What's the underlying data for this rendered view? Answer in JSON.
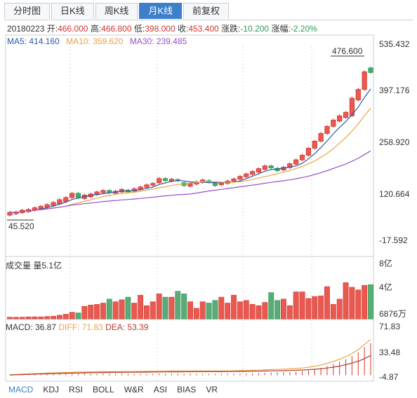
{
  "tabs": [
    {
      "label": "分时图",
      "active": false
    },
    {
      "label": "日K线",
      "active": false
    },
    {
      "label": "周K线",
      "active": false
    },
    {
      "label": "月K线",
      "active": true
    },
    {
      "label": "前复权",
      "active": false
    }
  ],
  "ohlc": {
    "date": "20180223",
    "open_label": "开:",
    "open": "466.000",
    "high_label": "高:",
    "high": "466.800",
    "low_label": "低:",
    "low": "398.000",
    "close_label": "收:",
    "close": "453.400",
    "change_label": "涨跌:",
    "change": "-10.200",
    "pct_label": "涨幅:",
    "pct": "-2.20%"
  },
  "ma": {
    "ma5": "MA5: 414.160",
    "ma10": "MA10: 359.620",
    "ma30": "MA30: 239.485"
  },
  "volume": {
    "label": "成交量 量5.1亿"
  },
  "macd": {
    "macd": "MACD: 36.87",
    "diff": "DIFF: 71.83",
    "dea": "DEA: 53.39"
  },
  "bottom_tabs": [
    "MACD",
    "KDJ",
    "RSI",
    "BOLL",
    "W&R",
    "ASI",
    "BIAS",
    "VR"
  ],
  "colors": {
    "up": "#d2352d",
    "down": "#2d9a52",
    "ma5": "#2b5aa8",
    "ma10": "#e8a34a",
    "ma30": "#9a4fc4",
    "accent": "#3d7fcb"
  },
  "chart_data": {
    "type": "candlestick",
    "price_axis_ticks": [
      "535.432",
      "397.176",
      "258.920",
      "120.664",
      "-17.592"
    ],
    "price_ylim": [
      -17.592,
      535.432
    ],
    "max_label": "476.600",
    "min_label": "45.520",
    "volume_axis_ticks": [
      "8亿",
      "4亿",
      "6876万"
    ],
    "volume_ylim": [
      0,
      8
    ],
    "macd_axis_ticks": [
      "71.83",
      "33.48",
      "-4.87"
    ],
    "macd_ylim": [
      -4.87,
      71.83
    ],
    "candles": [
      [
        48,
        56
      ],
      [
        52,
        57
      ],
      [
        55,
        62
      ],
      [
        58,
        64
      ],
      [
        62,
        69
      ],
      [
        66,
        73
      ],
      [
        70,
        78
      ],
      [
        75,
        84
      ],
      [
        80,
        92
      ],
      [
        86,
        98
      ],
      [
        98,
        110
      ],
      [
        110,
        98
      ],
      [
        95,
        105
      ],
      [
        100,
        108
      ],
      [
        106,
        114
      ],
      [
        112,
        118
      ],
      [
        118,
        112
      ],
      [
        110,
        116
      ],
      [
        114,
        121
      ],
      [
        119,
        114
      ],
      [
        116,
        123
      ],
      [
        121,
        128
      ],
      [
        127,
        134
      ],
      [
        133,
        138
      ],
      [
        140,
        152
      ],
      [
        152,
        146
      ],
      [
        145,
        150
      ],
      [
        149,
        146
      ],
      [
        140,
        132
      ],
      [
        130,
        138
      ],
      [
        136,
        142
      ],
      [
        141,
        148
      ],
      [
        146,
        142
      ],
      [
        138,
        132
      ],
      [
        134,
        139
      ],
      [
        138,
        145
      ],
      [
        144,
        151
      ],
      [
        150,
        158
      ],
      [
        157,
        165
      ],
      [
        164,
        172
      ],
      [
        170,
        180
      ],
      [
        178,
        188
      ],
      [
        188,
        182
      ],
      [
        181,
        174
      ],
      [
        176,
        184
      ],
      [
        183,
        194
      ],
      [
        193,
        205
      ],
      [
        205,
        218
      ],
      [
        218,
        238
      ],
      [
        238,
        258
      ],
      [
        258,
        280
      ],
      [
        280,
        300
      ],
      [
        300,
        318
      ],
      [
        315,
        330
      ],
      [
        325,
        340
      ],
      [
        330,
        380
      ],
      [
        375,
        405
      ],
      [
        405,
        455
      ],
      [
        466,
        453
      ]
    ],
    "volumes": [
      0.25,
      0.25,
      0.25,
      0.3,
      0.3,
      0.3,
      0.35,
      0.4,
      0.55,
      0.7,
      1.0,
      0.9,
      1.9,
      2.1,
      2.2,
      2.4,
      3.0,
      2.6,
      2.9,
      3.3,
      2.4,
      3.6,
      2.0,
      2.6,
      3.8,
      3.3,
      3.3,
      4.2,
      3.8,
      2.6,
      1.6,
      2.6,
      2.4,
      2.8,
      3.3,
      2.4,
      3.6,
      2.6,
      2.8,
      2.2,
      2.0,
      2.5,
      4.0,
      2.8,
      3.0,
      2.0,
      4.1,
      4.1,
      3.1,
      3.4,
      3.5,
      4.9,
      2.2,
      3.0,
      5.5,
      4.8,
      4.4,
      5.1,
      5.2
    ],
    "diff": [
      1,
      1.4,
      1.8,
      2.2,
      2.6,
      3.0,
      3.4,
      3.8,
      4.1,
      4.4,
      4.6,
      4.9,
      5.1,
      5.3,
      5.5,
      5.6,
      5.7,
      5.8,
      5.9,
      6.0,
      6.0,
      6.1,
      6.2,
      6.3,
      6.5,
      6.6,
      6.7,
      6.8,
      6.8,
      6.8,
      6.8,
      6.8,
      6.8,
      6.8,
      6.9,
      7.0,
      7.1,
      7.3,
      7.5,
      7.8,
      8.1,
      8.5,
      8.9,
      9.2,
      9.6,
      10,
      10.6,
      11.4,
      12.4,
      14,
      16,
      18.5,
      21.5,
      25,
      29,
      34,
      40,
      48,
      56
    ],
    "dea": [
      0.5,
      0.8,
      1.1,
      1.4,
      1.7,
      2.0,
      2.3,
      2.6,
      2.9,
      3.2,
      3.4,
      3.6,
      3.8,
      4.0,
      4.2,
      4.3,
      4.4,
      4.5,
      4.6,
      4.7,
      4.8,
      4.9,
      5.0,
      5.1,
      5.2,
      5.3,
      5.4,
      5.4,
      5.5,
      5.5,
      5.6,
      5.6,
      5.6,
      5.7,
      5.7,
      5.8,
      5.9,
      6.0,
      6.1,
      6.2,
      6.4,
      6.6,
      6.8,
      7.0,
      7.2,
      7.5,
      7.8,
      8.2,
      8.7,
      9.4,
      10.2,
      11.3,
      12.7,
      14.4,
      16.5,
      19,
      22,
      26,
      31
    ]
  }
}
